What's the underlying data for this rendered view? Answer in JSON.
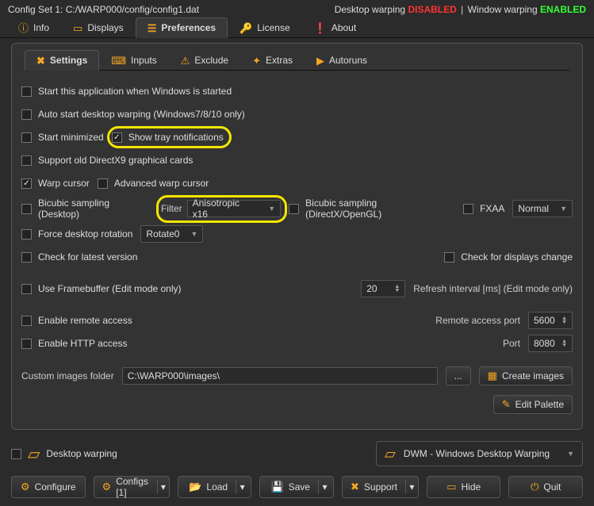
{
  "title_prefix": "Config Set 1:",
  "title_path": "C:/WARP000/config/config1.dat",
  "status": {
    "desktop_label": "Desktop warping",
    "desktop_state": "DISABLED",
    "window_label": "Window warping",
    "window_state": "ENABLED"
  },
  "main_tabs": {
    "info": "Info",
    "displays": "Displays",
    "preferences": "Preferences",
    "license": "License",
    "about": "About"
  },
  "sub_tabs": {
    "settings": "Settings",
    "inputs": "Inputs",
    "exclude": "Exclude",
    "extras": "Extras",
    "autoruns": "Autoruns"
  },
  "settings": {
    "start_with_windows": "Start this application when Windows is started",
    "auto_start_desktop": "Auto start desktop warping (Windows7/8/10 only)",
    "start_minimized": "Start minimized",
    "show_tray": "Show tray notifications",
    "support_dx9": "Support old DirectX9 graphical cards",
    "warp_cursor": "Warp cursor",
    "advanced_warp_cursor": "Advanced warp cursor",
    "bicubic_desktop": "Bicubic sampling (Desktop)",
    "filter_label": "Filter",
    "filter_value": "Anisotropic x16",
    "bicubic_dx": "Bicubic sampling (DirectX/OpenGL)",
    "fxaa": "FXAA",
    "fxaa_mode": "Normal",
    "force_rotation": "Force desktop rotation",
    "rotation_value": "Rotate0",
    "check_latest": "Check for latest version",
    "check_displays": "Check for displays change",
    "use_framebuffer": "Use Framebuffer (Edit mode only)",
    "refresh_value": "20",
    "refresh_label": "Refresh interval [ms] (Edit mode only)",
    "enable_remote": "Enable remote access",
    "remote_port_label": "Remote access port",
    "remote_port": "5600",
    "enable_http": "Enable HTTP access",
    "http_port_label": "Port",
    "http_port": "8080",
    "images_folder_label": "Custom images folder",
    "images_folder": "C:\\WARP000\\images\\",
    "browse": "...",
    "create_images": "Create images",
    "edit_palette": "Edit Palette"
  },
  "footer": {
    "desktop_warping_chk": "Desktop warping",
    "dwm_select": "DWM - Windows Desktop Warping"
  },
  "toolbar": {
    "configure": "Configure",
    "configs": "Configs [1]",
    "load": "Load",
    "save": "Save",
    "support": "Support",
    "hide": "Hide",
    "quit": "Quit"
  }
}
